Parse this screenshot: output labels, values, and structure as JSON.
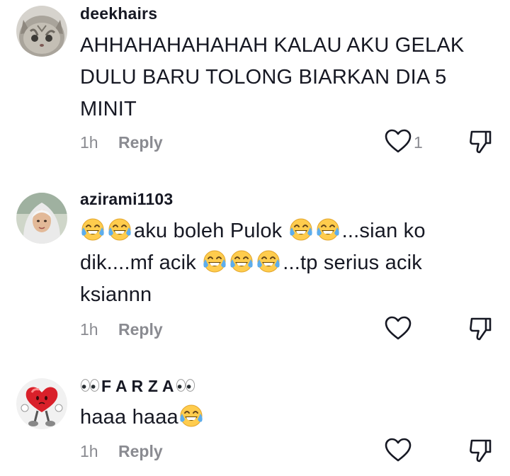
{
  "comments": [
    {
      "username": "deekhairs",
      "lines": [
        "AHHAHAHAHAHAH KALAU AKU GELAK",
        "DULU BARU TOLONG BIARKAN DIA 5",
        "MINIT"
      ],
      "time": "1h",
      "reply_label": "Reply",
      "like_count": "1",
      "avatar": "cat-avatar"
    },
    {
      "username": "azirami1103",
      "segments": {
        "l1a": "aku boleh Pulok ",
        "l1b": "...sian ko",
        "l2a": "dik....mf acik ",
        "l2b": "...tp serius acik",
        "l3": "ksiannn"
      },
      "time": "1h",
      "reply_label": "Reply",
      "like_count": "",
      "avatar": "hijab-avatar"
    },
    {
      "username_text": "F A R Z A",
      "text": "haaa haaa",
      "time": "1h",
      "reply_label": "Reply",
      "like_count": "",
      "avatar": "heart-character-avatar"
    }
  ],
  "icons": {
    "like": "heart-outline-icon",
    "dislike": "thumbs-down-icon",
    "emoji": "tears-of-joy-emoji",
    "eyes": "eyes-emoji"
  },
  "colors": {
    "text": "#161823",
    "muted": "#8a8b91",
    "background": "#ffffff"
  }
}
